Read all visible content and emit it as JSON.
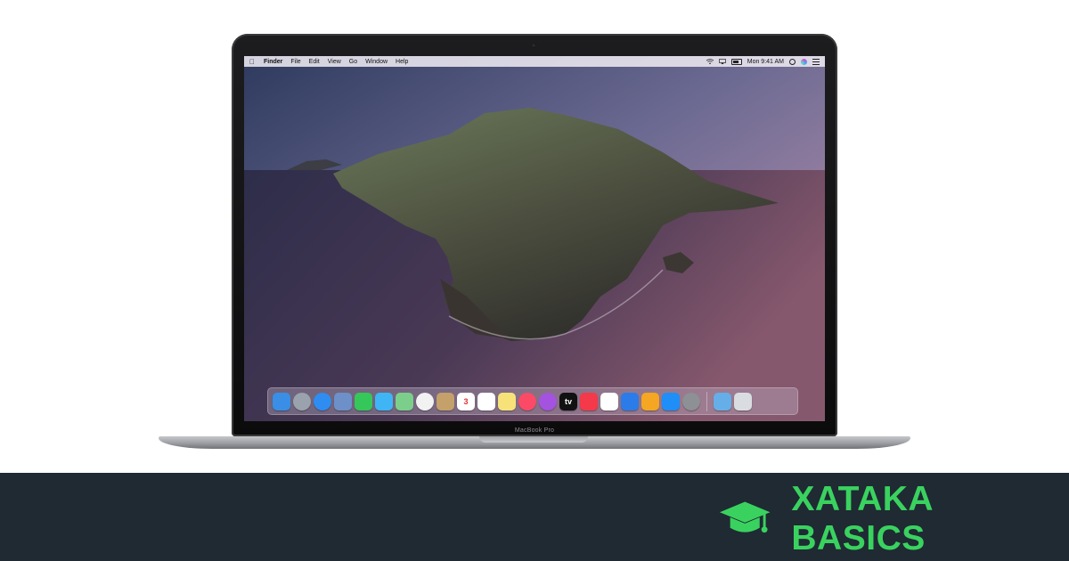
{
  "menubar": {
    "apple_glyph": "",
    "items": [
      "Finder",
      "File",
      "Edit",
      "View",
      "Go",
      "Window",
      "Help"
    ],
    "clock": "Mon 9:41 AM",
    "status_icons": [
      "wifi-icon",
      "airplay-icon",
      "battery-icon",
      "search-icon",
      "siri-icon",
      "notification-center-icon"
    ]
  },
  "dock": {
    "apps": [
      {
        "name": "finder-icon",
        "color": "#3a8ee6"
      },
      {
        "name": "launchpad-icon",
        "color": "#9aa3ad"
      },
      {
        "name": "safari-icon",
        "color": "#2f8df1"
      },
      {
        "name": "photo-booth-icon",
        "color": "#6d90c9"
      },
      {
        "name": "facetime-icon",
        "color": "#35c75a"
      },
      {
        "name": "messages-icon",
        "color": "#3fb5f5"
      },
      {
        "name": "maps-icon",
        "color": "#7ccf8a"
      },
      {
        "name": "photos-icon",
        "color": "#f2f2f2"
      },
      {
        "name": "contacts-icon",
        "color": "#c4a06b"
      },
      {
        "name": "calendar-icon",
        "color": "#ffffff",
        "text": "3"
      },
      {
        "name": "reminders-icon",
        "color": "#ffffff"
      },
      {
        "name": "notes-icon",
        "color": "#f7e27a"
      },
      {
        "name": "music-icon",
        "color": "#fb4a66"
      },
      {
        "name": "podcasts-icon",
        "color": "#a453e0"
      },
      {
        "name": "apple-tv-icon",
        "color": "#111111",
        "text": "tv"
      },
      {
        "name": "news-icon",
        "color": "#f4394a"
      },
      {
        "name": "numbers-icon",
        "color": "#ffffff"
      },
      {
        "name": "keynote-icon",
        "color": "#2b7ce9"
      },
      {
        "name": "pages-icon",
        "color": "#f5a623"
      },
      {
        "name": "app-store-icon",
        "color": "#1f8ef7"
      },
      {
        "name": "system-preferences-icon",
        "color": "#8d9095"
      }
    ],
    "extras": [
      {
        "name": "downloads-folder-icon",
        "color": "#66aee8"
      },
      {
        "name": "trash-icon",
        "color": "#d9dde2"
      }
    ]
  },
  "device": {
    "model_label": "MacBook Pro"
  },
  "footer": {
    "brand": "XATAKA BASICS",
    "brand_color": "#3ad25f",
    "background": "#1f2a33",
    "logo_icon": "graduation-cap-icon"
  }
}
